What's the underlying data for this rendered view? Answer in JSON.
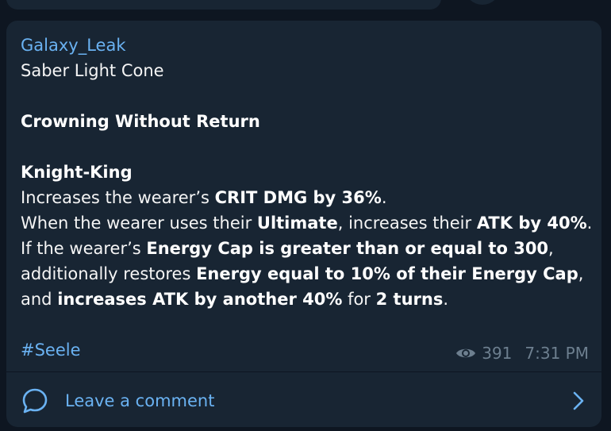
{
  "message": {
    "author": "Galaxy_Leak",
    "line_subtitle": "Saber Light Cone",
    "line_name": "Crowning Without Return",
    "line_skill": "Knight-King",
    "l1_a": "Increases the wearer’s ",
    "l1_b": "CRIT DMG by 36%",
    "l1_c": ".",
    "l2_a": "When the wearer uses their ",
    "l2_b": "Ultimate",
    "l2_c": ", increases their ",
    "l2_d": "ATK by 40%",
    "l2_e": ".",
    "l3_a": "If the wearer’s ",
    "l3_b": "Energy Cap is greater than or equal to 300",
    "l3_c": ",",
    "l4_a": "additionally restores ",
    "l4_b": "Energy equal to 10% of their Energy Cap",
    "l4_c": ",",
    "l5_a": "and ",
    "l5_b": "increases ATK by another 40%",
    "l5_c": " for ",
    "l5_d": "2 turns",
    "l5_e": ".",
    "hashtag": "#Seele",
    "views": "391",
    "time": "7:31 PM"
  },
  "comments": {
    "label": "Leave a comment",
    "icon": "comment-bubble-icon",
    "chevron_icon": "chevron-right-icon"
  },
  "colors": {
    "background": "#0e1621",
    "bubble": "#182533",
    "accent": "#6ab2f2",
    "text": "#f5f5f5",
    "meta": "#6d7f8f"
  }
}
